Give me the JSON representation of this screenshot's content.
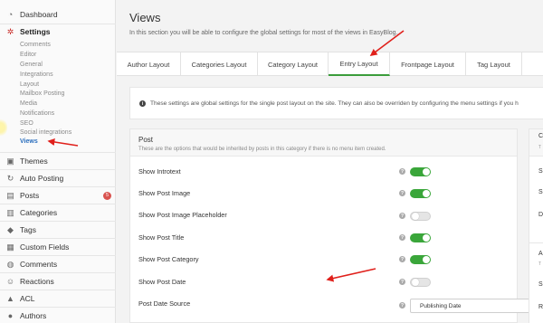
{
  "sidebar": {
    "items": [
      {
        "label": "Dashboard",
        "icon": "dashboard-icon",
        "glyph": "◔"
      },
      {
        "label": "Settings",
        "icon": "gear-icon",
        "glyph": "✲"
      },
      {
        "label": "Themes",
        "icon": "themes-icon",
        "glyph": "▣"
      },
      {
        "label": "Auto Posting",
        "icon": "share-icon",
        "glyph": "↻"
      },
      {
        "label": "Posts",
        "icon": "posts-icon",
        "glyph": "▤",
        "badge": "5"
      },
      {
        "label": "Categories",
        "icon": "categories-icon",
        "glyph": "▥"
      },
      {
        "label": "Tags",
        "icon": "tag-icon",
        "glyph": "◆"
      },
      {
        "label": "Custom Fields",
        "icon": "custom-fields-icon",
        "glyph": "▦"
      },
      {
        "label": "Comments",
        "icon": "comments-icon",
        "glyph": "◍"
      },
      {
        "label": "Reactions",
        "icon": "reactions-icon",
        "glyph": "☺"
      },
      {
        "label": "ACL",
        "icon": "lock-icon",
        "glyph": "▲"
      },
      {
        "label": "Authors",
        "icon": "user-icon",
        "glyph": "●"
      }
    ],
    "settings_sub": [
      "Comments",
      "Editor",
      "General",
      "Integrations",
      "Layout",
      "Mailbox Posting",
      "Media",
      "Notifications",
      "SEO",
      "Social integrations",
      "Views"
    ]
  },
  "header": {
    "title": "Views",
    "description": "In this section you will be able to configure the global settings for most of the views in EasyBlog."
  },
  "tabs": [
    "Author Layout",
    "Categories Layout",
    "Category Layout",
    "Entry Layout",
    "Frontpage Layout",
    "Tag Layout"
  ],
  "active_tab": "Entry Layout",
  "info": {
    "text": "These settings are global settings for the single post layout on the site. They can also be overriden by configuring the menu settings if you h"
  },
  "panel": {
    "title": "Post",
    "subtitle": "These are the options that would be inherited by posts in this category if there is no menu item created.",
    "rows": [
      {
        "label": "Show Introtext",
        "enabled": true
      },
      {
        "label": "Show Post Image",
        "enabled": true
      },
      {
        "label": "Show Post Image Placeholder",
        "enabled": false
      },
      {
        "label": "Show Post Title",
        "enabled": true
      },
      {
        "label": "Show Post Category",
        "enabled": true
      },
      {
        "label": "Show Post Date",
        "enabled": false
      }
    ],
    "date_source": {
      "label": "Post Date Source",
      "value": "Publishing Date"
    }
  },
  "side_panel": {
    "chars_top": [
      "C",
      "T",
      "S",
      "S",
      "D"
    ],
    "chars_bottom": [
      "A",
      "T",
      "S",
      "R"
    ]
  },
  "colors": {
    "accent_green": "#3aa63a",
    "badge_red": "#d9534f",
    "arrow_red": "#e0201b",
    "link_blue": "#2a6ebd"
  }
}
